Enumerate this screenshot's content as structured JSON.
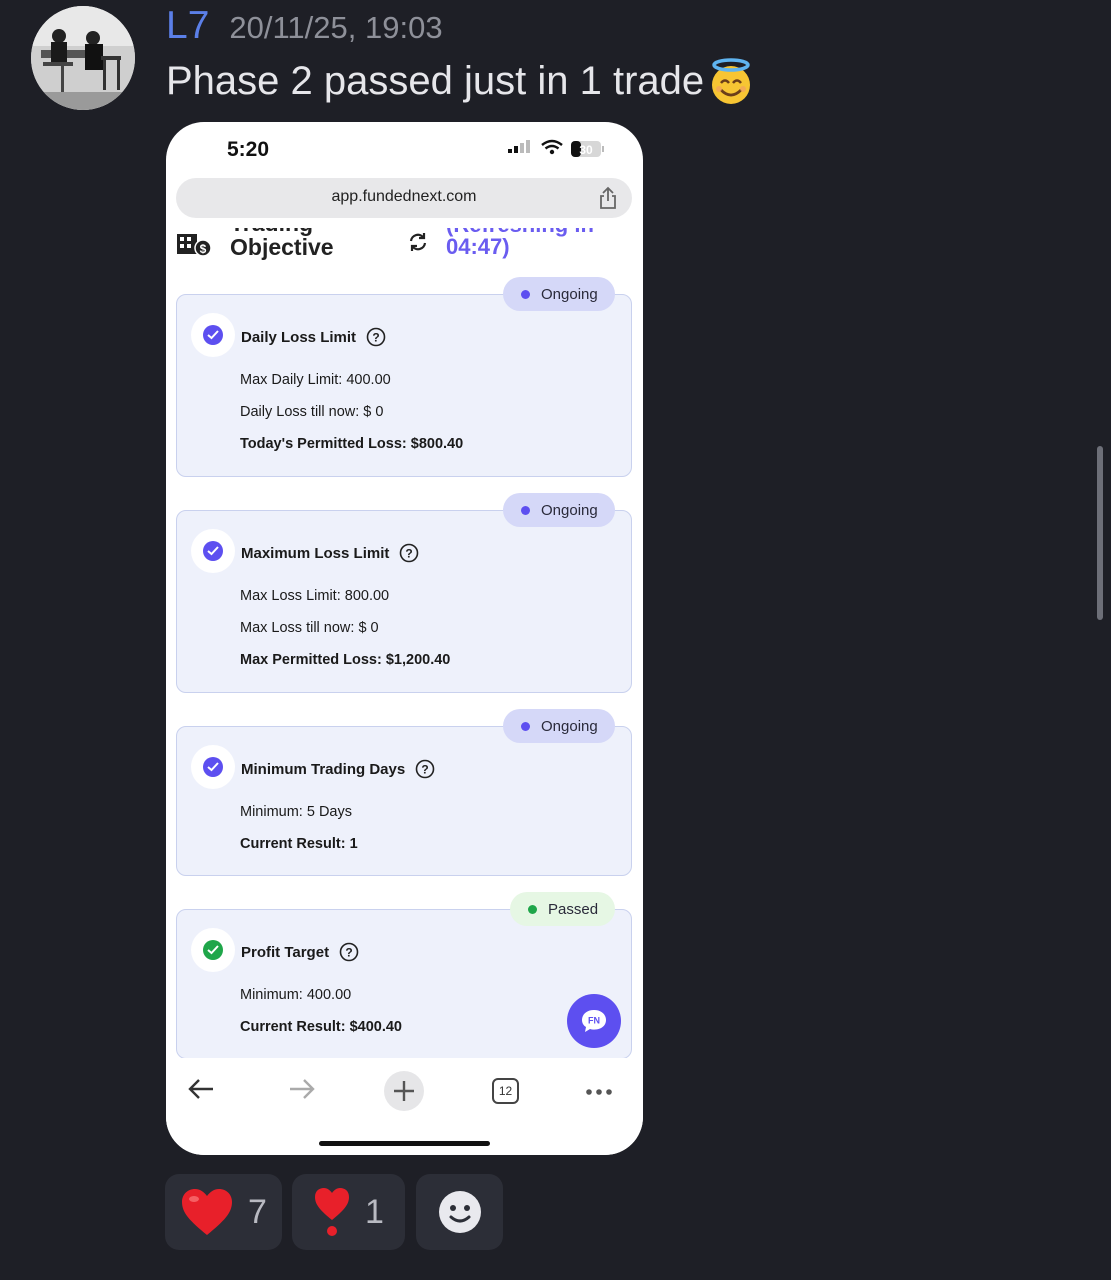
{
  "message": {
    "username": "L7",
    "timestamp": "20/11/25, 19:03",
    "text": "Phase 2 passed just in 1 trade",
    "emoji": "smiling-face-with-halo"
  },
  "phone": {
    "status_time": "5:20",
    "battery": "30",
    "url": "app.fundednext.com",
    "header": {
      "title_cut": "Trading",
      "title": "Objective",
      "refresh_cut": "(Refreshing in",
      "refresh_time": "04:47)"
    },
    "cards": [
      {
        "status": "Ongoing",
        "title": "Daily Loss Limit",
        "lines": [
          "Max Daily Limit: 400.00",
          "Daily Loss till now: $ 0",
          "Today's Permitted Loss: $800.40"
        ]
      },
      {
        "status": "Ongoing",
        "title": "Maximum Loss Limit",
        "lines": [
          "Max Loss Limit: 800.00",
          "Max Loss till now: $ 0",
          "Max Permitted Loss: $1,200.40"
        ]
      },
      {
        "status": "Ongoing",
        "title": "Minimum Trading Days",
        "lines": [
          "Minimum: 5 Days",
          "Current Result: 1"
        ]
      },
      {
        "status": "Passed",
        "title": "Profit Target",
        "lines": [
          "Minimum: 400.00",
          "Current Result: $400.40"
        ]
      }
    ],
    "fab_label": "FN",
    "tab_count": "12"
  },
  "reactions": [
    {
      "emoji": "heart",
      "count": "7"
    },
    {
      "emoji": "heart-exclamation",
      "count": "1"
    },
    {
      "emoji": "add-reaction"
    }
  ],
  "colors": {
    "background": "#1e1f26",
    "username": "#5b7fe8",
    "accent": "#5d4ff0",
    "passed": "#1fa64a"
  }
}
